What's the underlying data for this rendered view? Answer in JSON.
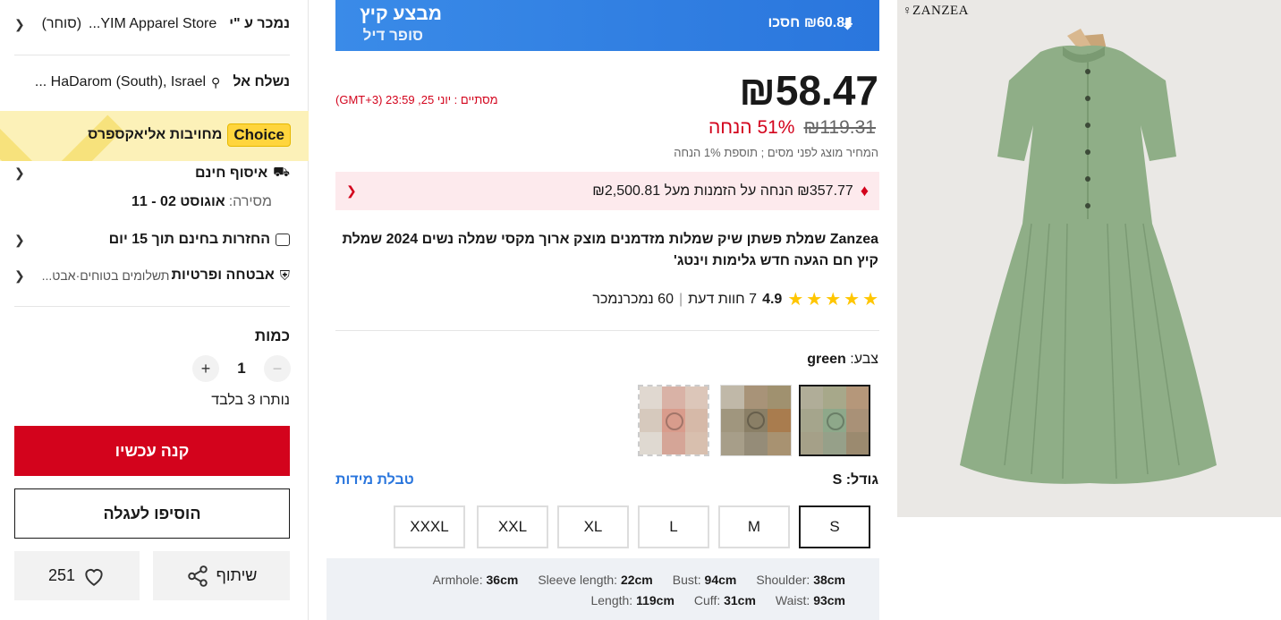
{
  "left": {
    "sold_by_label": "נמכר ע \"י",
    "store_name": "YIM Apparel Store...",
    "store_tag": "(סוחר)",
    "ship_to_label": "נשלח אל",
    "ship_to_value": "HaDarom (South), Israel ...",
    "choice_badge": "Choice",
    "choice_text": "מחויבות אליאקספרס",
    "free_pickup": "איסוף חינם",
    "delivery_label": "מסירה:",
    "delivery_value": "אוגוסט 02 - 11",
    "returns": "החזרות בחינם תוך 15 יום",
    "security": "אבטחה ופרטיות",
    "security_sub": "תשלומים בטוחים·אבט...",
    "quantity_label": "כמות",
    "quantity_value": "1",
    "stock_left": "נותרו 3 בלבד",
    "buy_now": "קנה עכשיו",
    "add_to_cart": "הוסיפו לעגלה",
    "share": "שיתוף",
    "wishlist_count": "251"
  },
  "banner": {
    "title": "מבצע קיץ",
    "subtitle": "סופר דיל",
    "save": "₪60.84 חסכו"
  },
  "price": {
    "current": "₪58.47",
    "original": "₪119.31",
    "discount": "51% הנחה",
    "tax_note": "המחיר מוצג לפני מסים ; תוספת 1% הנחה",
    "ends": "מסתיים : יוני 25, 23:59 (GMT+3)"
  },
  "coupon": {
    "text": "₪357.77 הנחה על הזמנות מעל ₪2,500.81"
  },
  "product": {
    "title": "Zanzea שמלת פשתן שיק שמלות מזדמנים מוצק ארוך מקסי שמלה נשים 2024 שמלת קיץ חם הגעה חדש גלימות וינטג'",
    "rating": "4.9",
    "reviews": "7 חוות דעת",
    "sold": "60 נמכרנמכר",
    "color_label": "צבע:",
    "color_value": "green",
    "size_label": "גודל: S",
    "size_chart": "טבלת מידות",
    "sizes": [
      "S",
      "M",
      "L",
      "XL",
      "XXL",
      "XXXL"
    ],
    "selected_size": "S",
    "brand_logo": "ZANZEA"
  },
  "specs": {
    "armhole_label": "Armhole:",
    "armhole": "36cm",
    "sleeve_label": "Sleeve length:",
    "sleeve": "22cm",
    "bust_label": "Bust:",
    "bust": "94cm",
    "shoulder_label": "Shoulder:",
    "shoulder": "38cm",
    "length_label": "Length:",
    "length": "119cm",
    "cuff_label": "Cuff:",
    "cuff": "31cm",
    "waist_label": "Waist:",
    "waist": "93cm"
  },
  "colors": {
    "accent_red": "#d3031c",
    "banner_blue": "#2f80e6",
    "choice_yellow": "#fcf1b8",
    "dress_green": "#8fae87"
  }
}
